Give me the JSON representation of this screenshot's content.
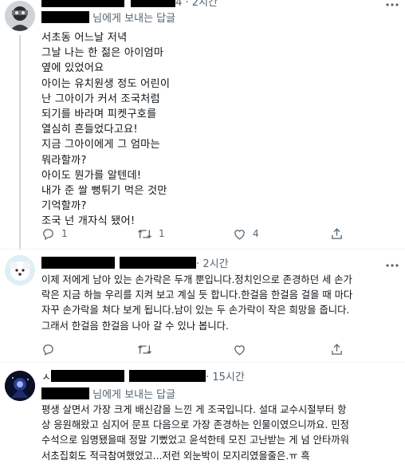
{
  "tweets": [
    {
      "time": "4 · 2시간",
      "reply_to_suffix": "님에게 보내는 답글",
      "lines": [
        "서초동 어느날 저녁",
        "그날 나는 한 젊은 아이엄마",
        "옆에 있었어요",
        "아이는 유치원생 정도 어린이",
        "난 그아이가 커서 조국처럼",
        "되기를 바라며 피켓구호를",
        "열심히 흔들었다고요!",
        "지금 그아이에게 그 엄마는",
        "뭐라할까?",
        "아이도 뭔가를 알텐데!",
        "내가 준 쌀 뻥튀기 먹은 것만",
        "기억할까?",
        "조국 넌 개자식 됐어!"
      ],
      "stats": {
        "replies": "1",
        "retweets": "1",
        "likes": "4"
      }
    },
    {
      "time": "· 2시간",
      "lines": [
        "이제 저에게 남아 있는 손가락은 두개 뿐입니다.정치인으로 존경하던 세 손가",
        "락은 지금 하늘 우리를 지켜 보고 계실 듯 합니다.한걸음 한걸음 걸을 때 마다",
        "자꾸 손가락을 쳐다 보게 됩니다.남이 있는 두 손가락이 작은 희망을 줍니다.",
        "그래서 한걸음 한걸음 나아 갈 수 있나 봅니다."
      ]
    },
    {
      "name_initial": "ㅅ",
      "time": "· 15시간",
      "reply_to_suffix": "님에게 보내는 답글",
      "lines": [
        "평생 살면서 가장 크게 배신감을 느낀 게 조국입니다. 설대 교수시절부터 항",
        "상 응원해왔고 심지어 문프 다음으로 가장 존경하는 인물이였으니까요. 민정",
        "수석으로 임명됐을때 정말 기뻤었고 윤석한테 모진 고난받는 게 넘 안타까워",
        "서초집회도 적극참여했었고...저런 외눈박이 모지리였을줄은.ㅠ 흑"
      ]
    }
  ],
  "colors": {
    "text": "#0f1419",
    "muted": "#536471",
    "divider": "#eff3f4",
    "thread": "#cfd9de"
  },
  "icons": [
    "more-icon",
    "reply-icon",
    "retweet-icon",
    "like-icon",
    "share-icon"
  ]
}
